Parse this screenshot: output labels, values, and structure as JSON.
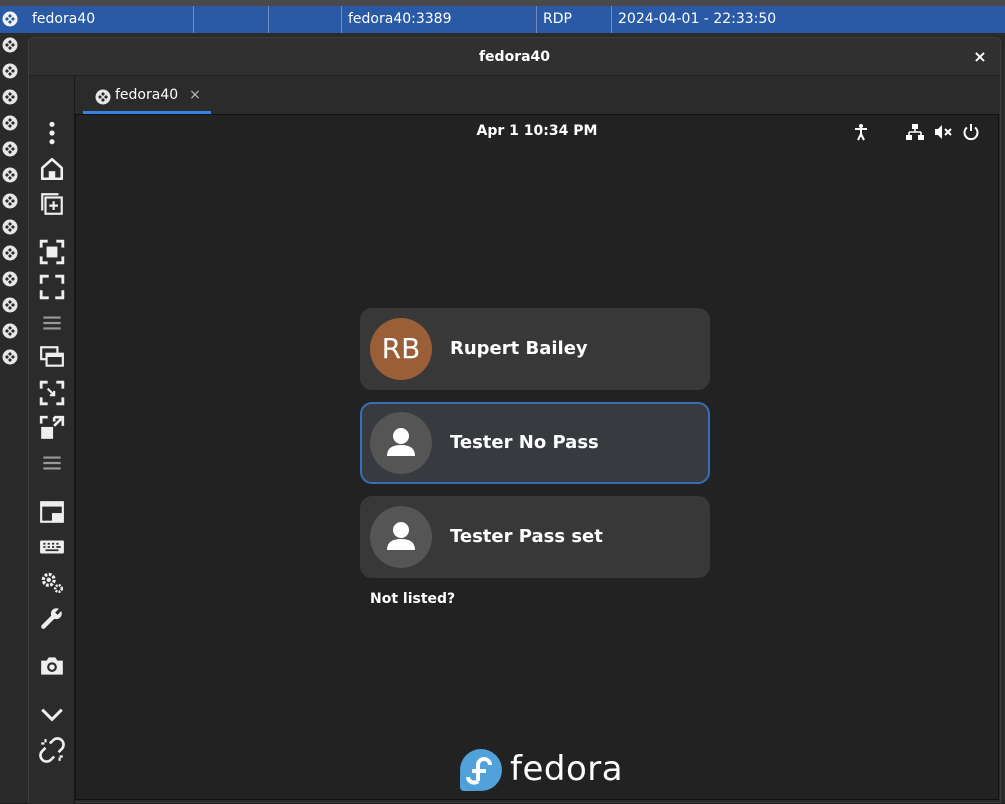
{
  "connection_row": {
    "name": "fedora40",
    "server": "fedora40:3389",
    "protocol": "RDP",
    "last_used": "2024-04-01 - 22:33:50"
  },
  "window": {
    "title": "fedora40",
    "close_glyph": "×"
  },
  "tab": {
    "label": "fedora40",
    "close_glyph": "×"
  },
  "toolbar": {
    "icons": [
      "menu-dots-icon",
      "home-icon",
      "new-connection-icon",
      "fit-window-icon",
      "fullscreen-icon",
      "separator-icon",
      "multi-monitor-icon",
      "scale-icon",
      "dynamic-resolution-icon",
      "separator-icon",
      "view-mode-icon",
      "keyboard-icon",
      "preferences-icon",
      "tools-icon",
      "screenshot-icon",
      "minimize-icon",
      "disconnect-icon"
    ]
  },
  "remote": {
    "clock": "Apr 1  10:34 PM",
    "system_icons": [
      "accessibility-icon",
      "network-icon",
      "volume-muted-icon",
      "power-icon"
    ],
    "users": [
      {
        "initials": "RB",
        "name": "Rupert Bailey",
        "avatar_color": "#9b5f38"
      },
      {
        "name": "Tester No Pass",
        "selected": true
      },
      {
        "name": "Tester Pass set"
      }
    ],
    "not_listed": "Not listed?",
    "logo_text": "fedora",
    "logo_color": "#51a2da"
  },
  "colors": {
    "selection_row": "#2a5aa6",
    "tab_accent": "#3584e4",
    "selected_border": "#3a6db3"
  }
}
